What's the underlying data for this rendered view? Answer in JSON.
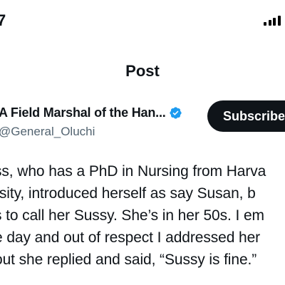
{
  "status_bar": {
    "time": "7",
    "signal_icon": "cellular-signal-icon"
  },
  "header": {
    "title": "Post"
  },
  "author": {
    "display_name": "A Field Marshal of the Han...",
    "handle": "@General_Oluchi",
    "verified_icon": "verified-badge-icon",
    "verified_color": "#1d9bf0"
  },
  "subscribe": {
    "label": "Subscribe"
  },
  "post": {
    "lines": [
      "ss, who has a PhD in Nursing from Harva",
      "rsity, introduced herself as say Susan, b",
      "s to call her Sussy. She’s in her 50s. I em",
      "e day and out of respect I addressed her",
      "out she replied and said, “Sussy is fine.”"
    ]
  },
  "colors": {
    "text": "#0f1419",
    "secondary_text": "#536471",
    "button_bg": "#0f1419",
    "button_text": "#ffffff"
  }
}
